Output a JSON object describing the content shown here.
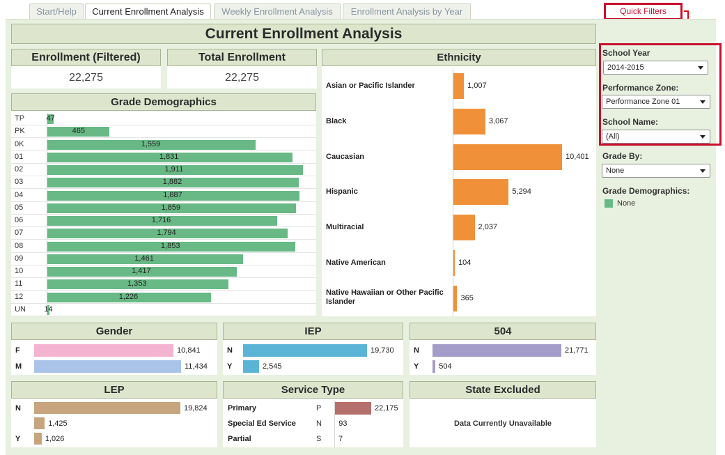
{
  "tabs": [
    "Start/Help",
    "Current Enrollment Analysis",
    "Weekly Enrollment Analysis",
    "Enrollment Analysis by Year"
  ],
  "quick_filters_label": "Quick Filters",
  "title": "Current Enrollment Analysis",
  "kpi": {
    "filtered_label": "Enrollment (Filtered)",
    "filtered_value": "22,275",
    "total_label": "Total Enrollment",
    "total_value": "22,275"
  },
  "grade": {
    "title": "Grade Demographics",
    "rows": [
      {
        "label": "TP",
        "value": 47,
        "text": "47"
      },
      {
        "label": "PK",
        "value": 465,
        "text": "465"
      },
      {
        "label": "0K",
        "value": 1559,
        "text": "1,559"
      },
      {
        "label": "01",
        "value": 1831,
        "text": "1,831"
      },
      {
        "label": "02",
        "value": 1911,
        "text": "1,911"
      },
      {
        "label": "03",
        "value": 1882,
        "text": "1,882"
      },
      {
        "label": "04",
        "value": 1887,
        "text": "1,887"
      },
      {
        "label": "05",
        "value": 1859,
        "text": "1,859"
      },
      {
        "label": "06",
        "value": 1716,
        "text": "1,716"
      },
      {
        "label": "07",
        "value": 1794,
        "text": "1,794"
      },
      {
        "label": "08",
        "value": 1853,
        "text": "1,853"
      },
      {
        "label": "09",
        "value": 1461,
        "text": "1,461"
      },
      {
        "label": "10",
        "value": 1417,
        "text": "1,417"
      },
      {
        "label": "11",
        "value": 1353,
        "text": "1,353"
      },
      {
        "label": "12",
        "value": 1226,
        "text": "1,226"
      },
      {
        "label": "UN",
        "value": 14,
        "text": "14"
      }
    ]
  },
  "ethnicity": {
    "title": "Ethnicity",
    "rows": [
      {
        "label": "Asian or Pacific Islander",
        "value": 1007,
        "text": "1,007"
      },
      {
        "label": "Black",
        "value": 3067,
        "text": "3,067"
      },
      {
        "label": "Caucasian",
        "value": 10401,
        "text": "10,401"
      },
      {
        "label": "Hispanic",
        "value": 5294,
        "text": "5,294"
      },
      {
        "label": "Multiracial",
        "value": 2037,
        "text": "2,037"
      },
      {
        "label": "Native American",
        "value": 104,
        "text": "104"
      },
      {
        "label": "Native Hawaiian or Other Pacific Islander",
        "value": 365,
        "text": "365"
      }
    ]
  },
  "gender": {
    "title": "Gender",
    "rows": [
      {
        "label": "F",
        "value": 10841,
        "text": "10,841"
      },
      {
        "label": "M",
        "value": 11434,
        "text": "11,434"
      }
    ]
  },
  "iep": {
    "title": "IEP",
    "rows": [
      {
        "label": "N",
        "value": 19730,
        "text": "19,730"
      },
      {
        "label": "Y",
        "value": 2545,
        "text": "2,545"
      }
    ]
  },
  "s504": {
    "title": "504",
    "rows": [
      {
        "label": "N",
        "value": 21771,
        "text": "21,771"
      },
      {
        "label": "Y",
        "value": 504,
        "text": "504"
      }
    ]
  },
  "lep": {
    "title": "LEP",
    "rows": [
      {
        "label": "N",
        "value": 19824,
        "text": "19,824"
      },
      {
        "label": "",
        "value": 1425,
        "text": "1,425"
      },
      {
        "label": "Y",
        "value": 1026,
        "text": "1,026"
      }
    ]
  },
  "service": {
    "title": "Service Type",
    "rows": [
      {
        "label": "Primary",
        "code": "P",
        "value": 22175,
        "text": "22,175"
      },
      {
        "label": "Special Ed Service",
        "code": "N",
        "value": 93,
        "text": "93"
      },
      {
        "label": "Partial",
        "code": "S",
        "value": 7,
        "text": "7"
      }
    ]
  },
  "state_excluded": {
    "title": "State Excluded",
    "message": "Data Currently Unavailable"
  },
  "filters": {
    "school_year_label": "School Year",
    "school_year_value": "2014-2015",
    "zone_label": "Performance Zone:",
    "zone_value": "Performance Zone 01",
    "school_label": "School Name:",
    "school_value": "(All)",
    "grade_by_label": "Grade By:",
    "grade_by_value": "None",
    "legend_label": "Grade Demographics:",
    "legend_item": "None"
  },
  "colors": {
    "grade": "#68b985",
    "ethnicity": "#f0913a",
    "gender_f": "#f4b3d0",
    "gender_m": "#a9c4e8",
    "iep": "#5ab4d6",
    "s504": "#a59dc9",
    "lep": "#c6a57f",
    "service_p": "#b5706b",
    "highlight": "#c8102e"
  }
}
